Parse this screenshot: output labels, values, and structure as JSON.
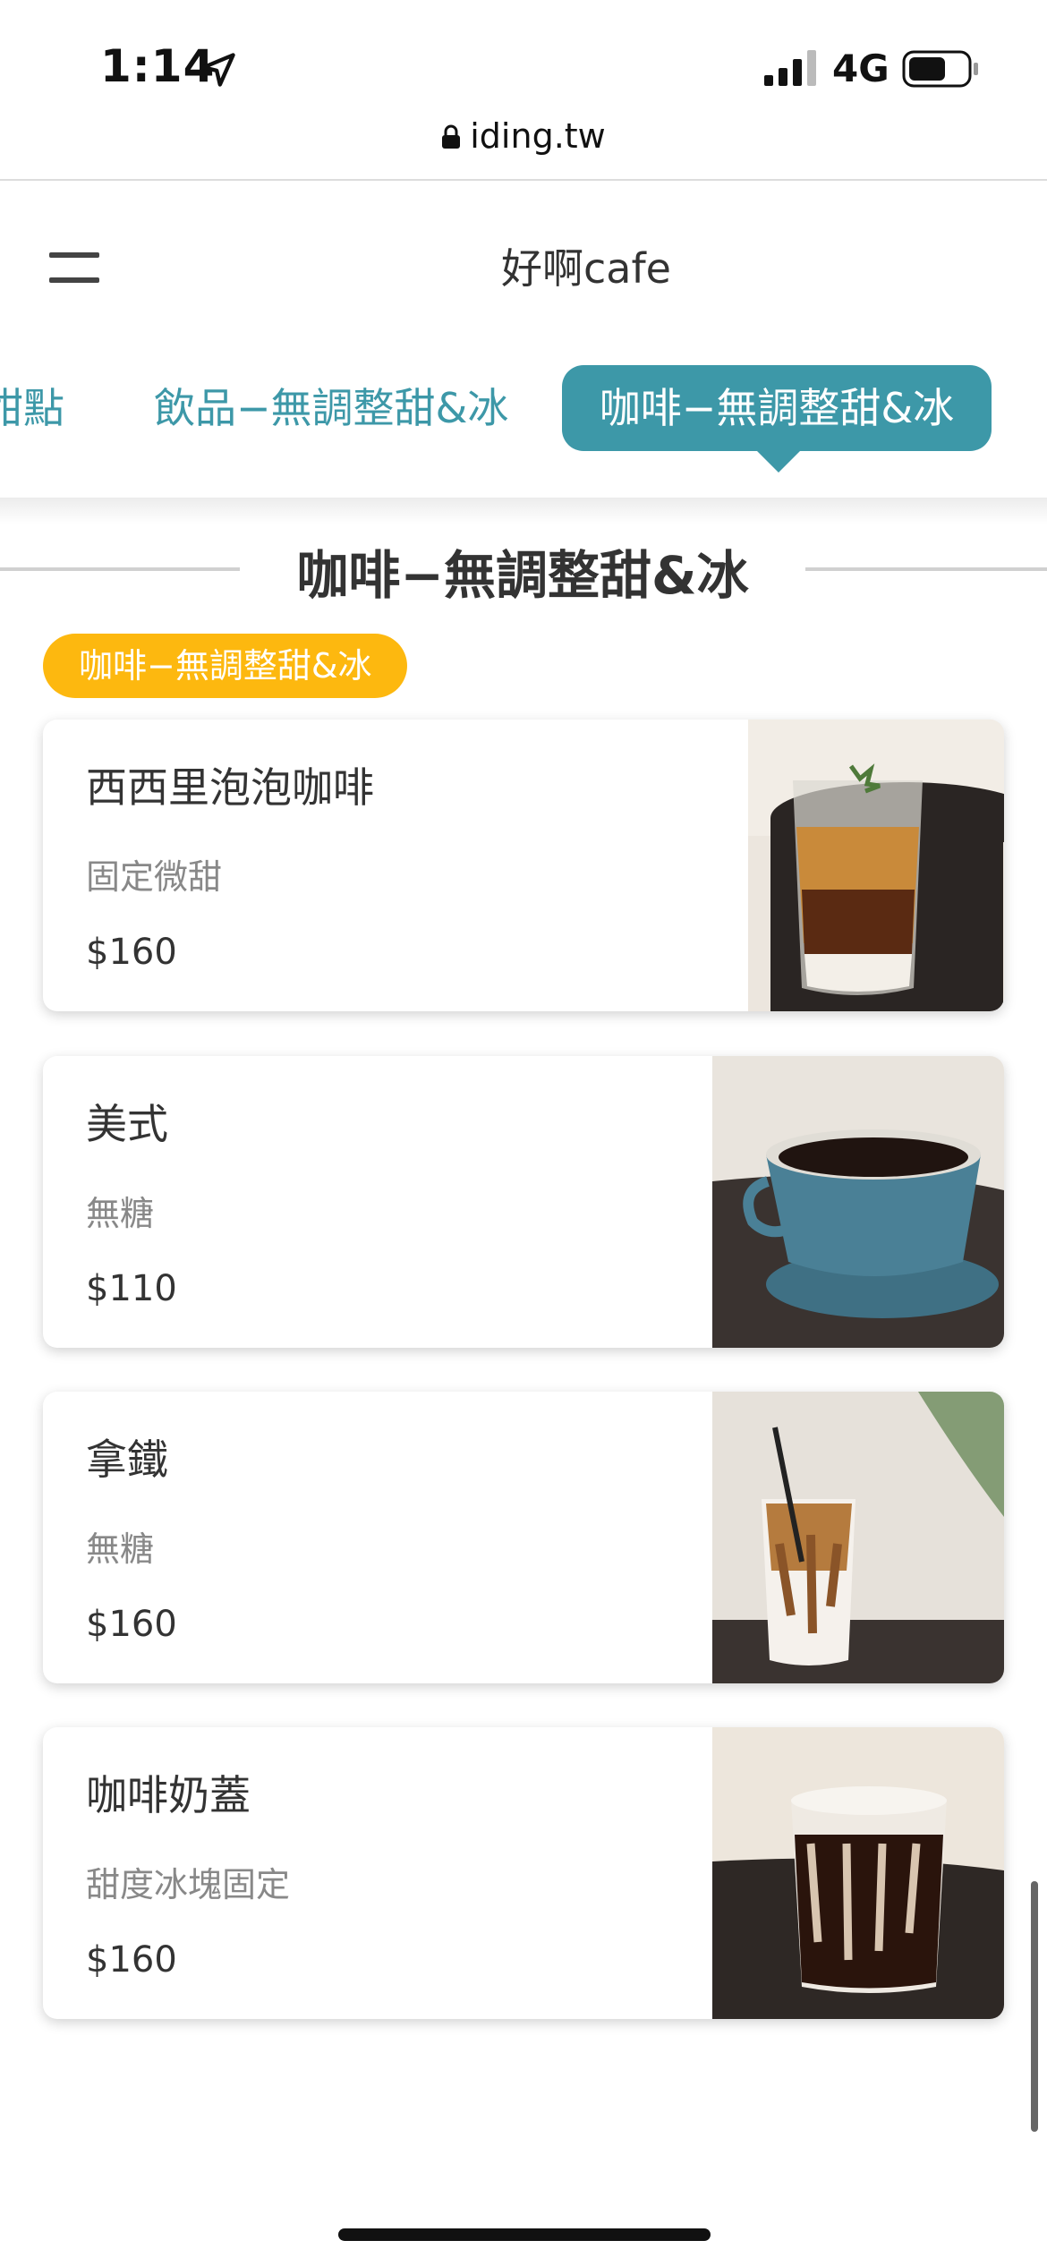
{
  "status_bar": {
    "time": "1:14",
    "network": "4G"
  },
  "browser": {
    "url": "iding.tw"
  },
  "header": {
    "title": "好啊cafe"
  },
  "tabs": [
    {
      "label": "甜點"
    },
    {
      "label": "飲品−無調整甜&冰"
    },
    {
      "label": "咖啡−無調整甜&冰",
      "active": true
    }
  ],
  "section": {
    "heading": "咖啡−無調整甜&冰",
    "badge": "咖啡−無調整甜&冰"
  },
  "items": [
    {
      "name": "西西里泡泡咖啡",
      "desc": "固定微甜",
      "price": "$160"
    },
    {
      "name": "美式",
      "desc": "無糖",
      "price": "$110"
    },
    {
      "name": "拿鐵",
      "desc": "無糖",
      "price": "$160"
    },
    {
      "name": "咖啡奶蓋",
      "desc": "甜度冰塊固定",
      "price": "$160"
    }
  ],
  "colors": {
    "accent": "#3d98a8",
    "badge": "#fdb80f"
  }
}
